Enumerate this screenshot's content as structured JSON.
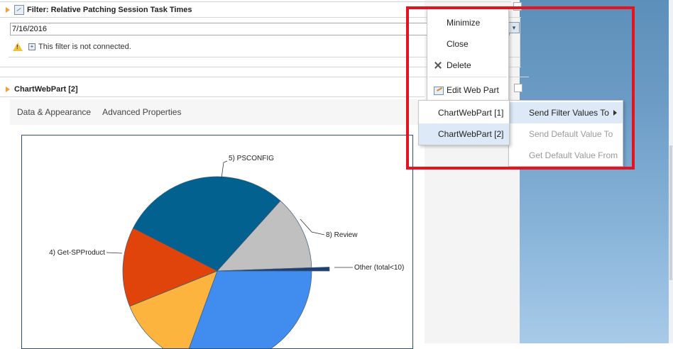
{
  "filter_webpart": {
    "title": "Filter: Relative Patching Session Task Times",
    "date_value": "7/16/2016",
    "warning_text": "This filter is not connected."
  },
  "chart_webpart": {
    "title": "ChartWebPart [2]",
    "tabs": [
      "Data & Appearance",
      "Advanced Properties"
    ]
  },
  "web_part_menu": {
    "items": [
      {
        "label": "Minimize",
        "icon": ""
      },
      {
        "label": "Close",
        "icon": ""
      },
      {
        "label": "Delete",
        "icon": "x-icon"
      },
      {
        "label": "Edit Web Part",
        "icon": "edit-icon"
      }
    ]
  },
  "connection_menu": {
    "items": [
      "Send Filter Values To",
      "Send Default Value To",
      "Get Default Value From"
    ],
    "targets": [
      "ChartWebPart [1]",
      "ChartWebPart [2]"
    ]
  },
  "chart_data": {
    "type": "pie",
    "slices": [
      {
        "label": "5) PSCONFIG",
        "color": "#03618f"
      },
      {
        "label": "8) Review",
        "color": "#c0c0c0"
      },
      {
        "label": "Other (total<10)",
        "color": "#1f3f73"
      },
      {
        "label": "",
        "color": "#418cef"
      },
      {
        "label": "",
        "color": "#fdb43f"
      },
      {
        "label": "4) Get-SPProduct",
        "color": "#e1440b"
      }
    ]
  },
  "colors": {
    "highlight_frame": "#e3141e",
    "selected_item": "#dde9f6"
  }
}
